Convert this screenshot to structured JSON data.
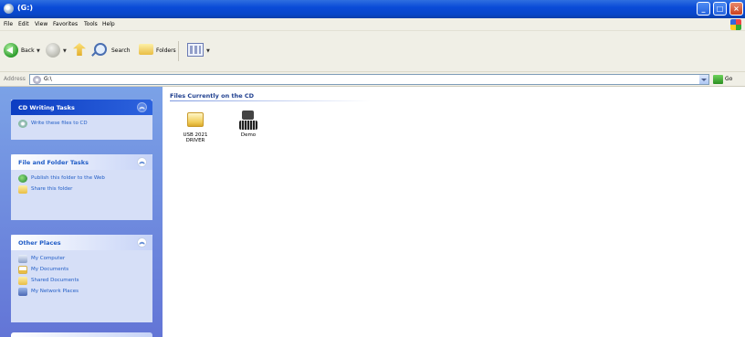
{
  "window": {
    "title": "(G:)"
  },
  "menubar": {
    "items": [
      "File",
      "Edit",
      "View",
      "Favorites",
      "Tools",
      "Help"
    ]
  },
  "toolbar": {
    "back_label": "Back",
    "search_label": "Search",
    "folders_label": "Folders"
  },
  "addressbar": {
    "label": "Address",
    "value": "G:\\",
    "go_label": "Go"
  },
  "taskpane": {
    "cd_tasks": {
      "title": "CD Writing Tasks",
      "items": [
        "Write these files to CD"
      ]
    },
    "file_folder_tasks": {
      "title": "File and Folder Tasks",
      "items": [
        "Publish this folder to the Web",
        "Share this folder"
      ]
    },
    "other_places": {
      "title": "Other Places",
      "items": [
        "My Computer",
        "My Documents",
        "Shared Documents",
        "My Network Places"
      ]
    }
  },
  "content": {
    "group_title": "Files Currently on the CD",
    "files": [
      {
        "name": "USB 2021 DRIVER",
        "icon": "folder-icon"
      },
      {
        "name": "Demo",
        "icon": "setup-icon"
      }
    ]
  },
  "colors": {
    "titlebar": "#0a4bd8",
    "taskpane": "#6f8ede",
    "link": "#215dc6"
  }
}
